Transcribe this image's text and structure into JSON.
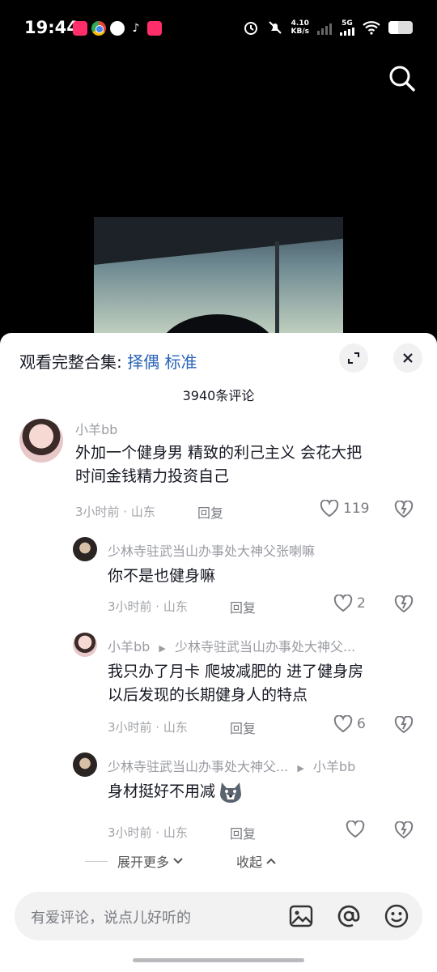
{
  "status_bar": {
    "time": "19:44",
    "net_speed_value": "4.10",
    "net_speed_unit": "KB/s",
    "network": "5G"
  },
  "sheet": {
    "title_prefix": "观看完整合集:",
    "title_highlight": "择偶 标准",
    "comment_count": "3940条评论"
  },
  "comments": [
    {
      "user": "小羊bb",
      "text_line1": "外加一个健身男 精致的利己主义 会花大把",
      "text_line2": "时间金钱精力投资自己",
      "meta": "3小时前 · 山东",
      "reply_label": "回复",
      "likes": "119"
    },
    {
      "user": "少林寺驻武当山办事处大神父张喇嘛",
      "text": "你不是也健身嘛",
      "meta": "3小时前 · 山东",
      "reply_label": "回复",
      "likes": "2"
    },
    {
      "user": "小羊bb",
      "reply_to": "少林寺驻武当山办事处大神父...",
      "text_line1": "我只办了月卡 爬坡减肥的 进了健身房",
      "text_line2": "以后发现的长期健身人的特点",
      "meta": "3小时前 · 山东",
      "reply_label": "回复",
      "likes": "6"
    },
    {
      "user": "少林寺驻武当山办事处大神父...",
      "reply_to": "小羊bb",
      "text": "身材挺好不用减",
      "meta": "3小时前 · 山东",
      "reply_label": "回复",
      "likes": ""
    }
  ],
  "expand_more": "展开更多",
  "collapse": "收起",
  "input": {
    "placeholder": "有爱评论，说点儿好听的"
  },
  "icons": [
    "search-icon",
    "expand-icon",
    "close-icon",
    "heart-icon",
    "dislike-icon",
    "image-icon",
    "at-icon",
    "emoji-icon"
  ]
}
